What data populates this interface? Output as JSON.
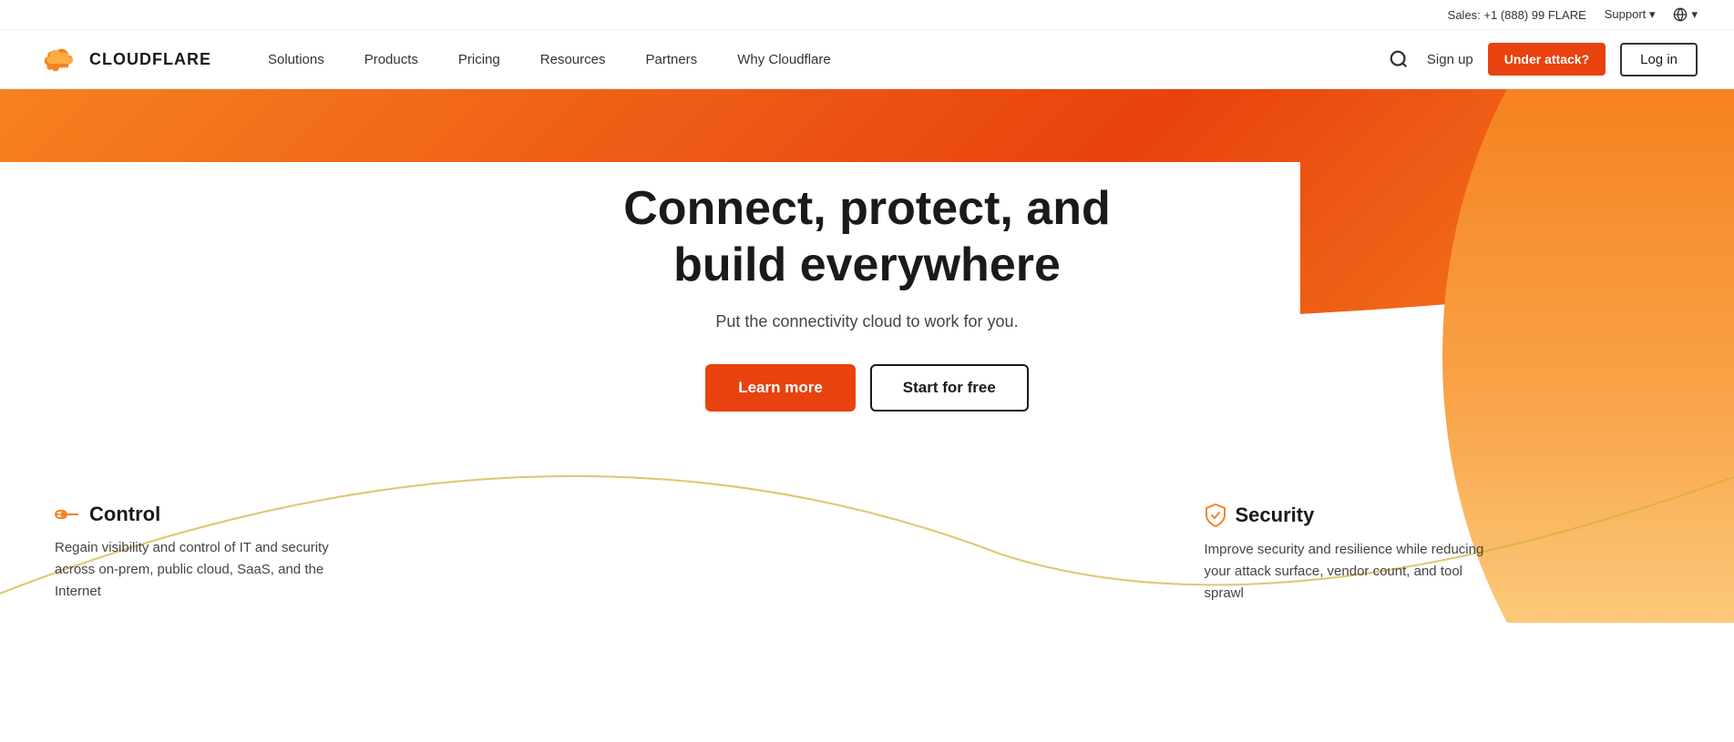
{
  "header": {
    "sales_label": "Sales: +1 (888) 99 FLARE",
    "support_label": "Support",
    "logo_text": "CLOUDFLARE",
    "nav": [
      {
        "id": "solutions",
        "label": "Solutions"
      },
      {
        "id": "products",
        "label": "Products"
      },
      {
        "id": "pricing",
        "label": "Pricing"
      },
      {
        "id": "resources",
        "label": "Resources"
      },
      {
        "id": "partners",
        "label": "Partners"
      },
      {
        "id": "why-cloudflare",
        "label": "Why Cloudflare"
      }
    ],
    "signup_label": "Sign up",
    "attack_label": "Under attack?",
    "login_label": "Log in"
  },
  "hero": {
    "title_line1": "Connect, protect, and",
    "title_line2": "build everywhere",
    "subtitle": "Put the connectivity cloud to work for you.",
    "learn_more_label": "Learn more",
    "start_free_label": "Start for free"
  },
  "features": [
    {
      "id": "control",
      "icon": "🔗",
      "title": "Control",
      "description": "Regain visibility and control of IT and security across on-prem, public cloud, SaaS, and the Internet"
    },
    {
      "id": "security",
      "icon": "🛡",
      "title": "Security",
      "description": "Improve security and resilience while reducing your attack surface, vendor count, and tool sprawl"
    }
  ],
  "colors": {
    "orange_primary": "#f6821f",
    "orange_dark": "#e8420e",
    "text_dark": "#1a1a1a",
    "text_mid": "#444"
  }
}
